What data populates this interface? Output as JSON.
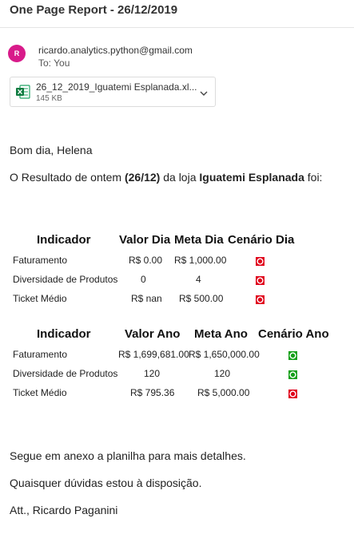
{
  "subject": "One Page Report - 26/12/2019",
  "sender": {
    "initial": "R",
    "email": "ricardo.analytics.python@gmail.com",
    "to_label": "To:",
    "to_value": "You",
    "avatar_color": "#d81b8a"
  },
  "attachment": {
    "name": "26_12_2019_Iguatemi Esplanada.xl...",
    "size": "145 KB",
    "icon": "excel-file-icon"
  },
  "body": {
    "greeting": "Bom dia, Helena",
    "intro_pre": "O Resultado de ontem ",
    "intro_date": "(26/12)",
    "intro_mid": " da loja ",
    "intro_store": "Iguatemi Esplanada",
    "intro_post": " foi:",
    "closing1": "Segue em anexo a planilha para mais detalhes.",
    "closing2": "Quaisquer dúvidas estou à disposição.",
    "signature": "Att., Ricardo Paganini"
  },
  "colors": {
    "status_red": "#e0001b",
    "status_green": "#16a01a"
  },
  "table_day": {
    "headers": [
      "Indicador",
      "Valor Dia",
      "Meta Dia",
      "Cenário Dia"
    ],
    "rows": [
      {
        "indicador": "Faturamento",
        "valor": "R$ 0.00",
        "meta": "R$ 1,000.00",
        "status": "red"
      },
      {
        "indicador": "Diversidade de Produtos",
        "valor": "0",
        "meta": "4",
        "status": "red"
      },
      {
        "indicador": "Ticket Médio",
        "valor": "R$ nan",
        "meta": "R$ 500.00",
        "status": "red"
      }
    ]
  },
  "table_year": {
    "headers": [
      "Indicador",
      "Valor Ano",
      "Meta Ano",
      "Cenário Ano"
    ],
    "rows": [
      {
        "indicador": "Faturamento",
        "valor": "R$ 1,699,681.00",
        "meta": "R$ 1,650,000.00",
        "status": "green"
      },
      {
        "indicador": "Diversidade de Produtos",
        "valor": "120",
        "meta": "120",
        "status": "green"
      },
      {
        "indicador": "Ticket Médio",
        "valor": "R$ 795.36",
        "meta": "R$ 5,000.00",
        "status": "red"
      }
    ]
  }
}
